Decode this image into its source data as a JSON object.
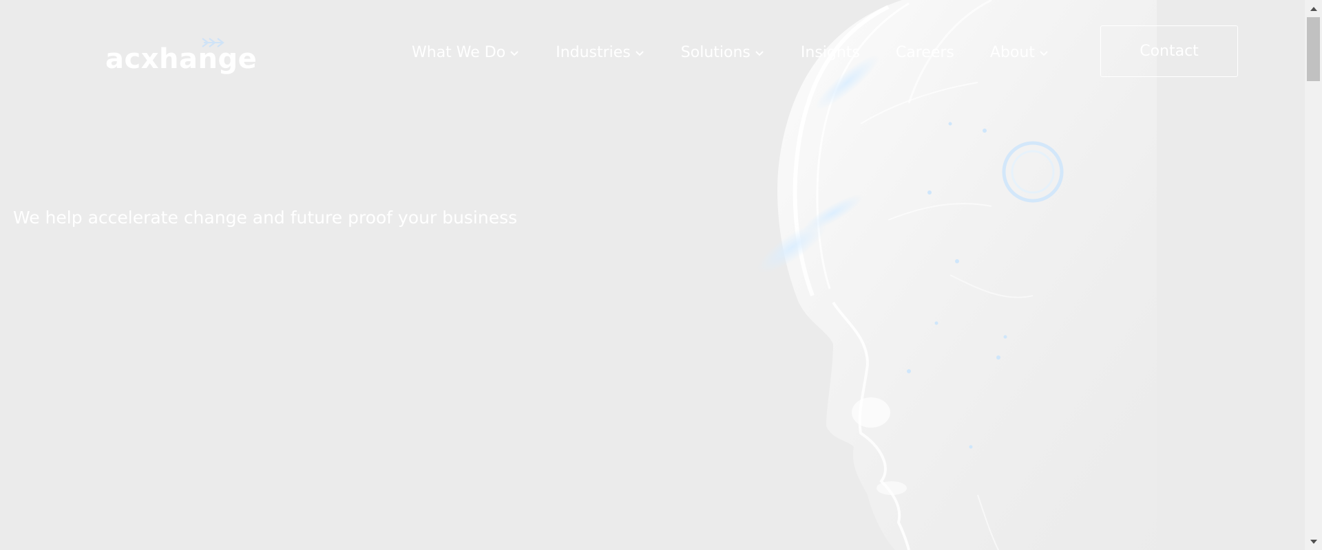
{
  "brand": {
    "logo_text": "acxhange",
    "logo_icon": "double-chevron-arrow-icon"
  },
  "nav": {
    "items": [
      {
        "label": "What We Do",
        "has_dropdown": true
      },
      {
        "label": "Industries",
        "has_dropdown": true
      },
      {
        "label": "Solutions",
        "has_dropdown": true
      },
      {
        "label": "Insights",
        "has_dropdown": false
      },
      {
        "label": "Careers",
        "has_dropdown": false
      },
      {
        "label": "About",
        "has_dropdown": true
      }
    ],
    "contact_label": "Contact"
  },
  "hero": {
    "tagline": "We help accelerate change and future proof your business",
    "image": "robot-head-illustration"
  },
  "colors": {
    "background": "#ebebeb",
    "text": "#ffffff",
    "accent": "#cfe3f7"
  }
}
